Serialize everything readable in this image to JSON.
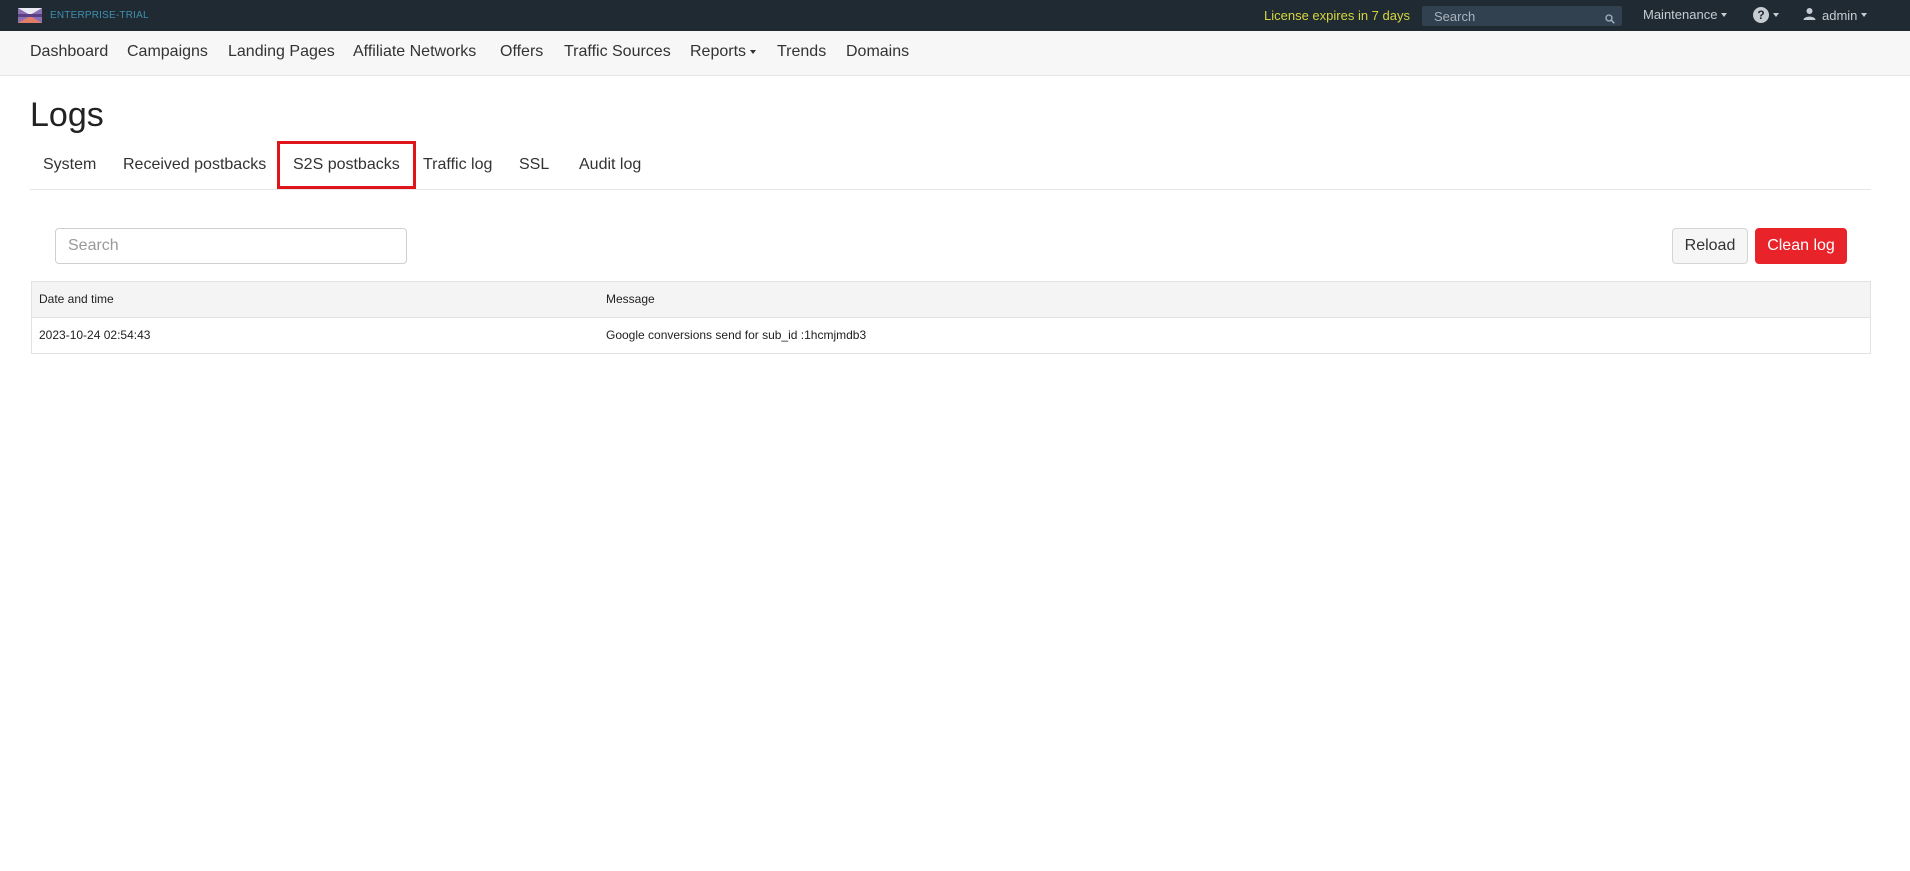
{
  "topbar": {
    "brand_text": "ENTERPRISE-TRIAL",
    "license_text": "License expires in 7 days",
    "search_placeholder": "Search",
    "maintenance_label": "Maintenance",
    "help_symbol": "?",
    "user_label": "admin",
    "colors": {
      "background": "#1f2a33",
      "license": "#d6d63c",
      "brand": "#3f8fb0"
    },
    "icons": {
      "search": "search-icon",
      "user": "user-icon",
      "help": "help-circle-icon"
    }
  },
  "nav": {
    "items": [
      {
        "label": "Dashboard"
      },
      {
        "label": "Campaigns"
      },
      {
        "label": "Landing Pages"
      },
      {
        "label": "Affiliate Networks"
      },
      {
        "label": "Offers"
      },
      {
        "label": "Traffic Sources"
      },
      {
        "label": "Reports"
      },
      {
        "label": "Trends"
      },
      {
        "label": "Domains"
      }
    ]
  },
  "page": {
    "title": "Logs",
    "tabs": [
      {
        "label": "System"
      },
      {
        "label": "Received postbacks"
      },
      {
        "label": "S2S postbacks",
        "active": true
      },
      {
        "label": "Traffic log"
      },
      {
        "label": "SSL"
      },
      {
        "label": "Audit log"
      }
    ],
    "search_placeholder": "Search",
    "reload_label": "Reload",
    "clean_label": "Clean log",
    "colors": {
      "active_tab_border": "#e0141b",
      "clean_button": "#e8232a"
    }
  },
  "table": {
    "headers": [
      "Date and time",
      "Message"
    ],
    "rows": [
      [
        "2023-10-24 02:54:43",
        "Google conversions send for sub_id :1hcmjmdb3"
      ]
    ]
  }
}
